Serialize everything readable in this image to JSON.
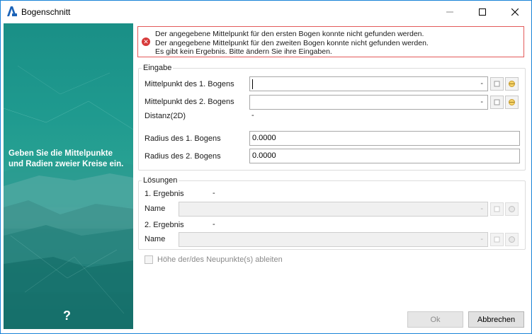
{
  "window": {
    "title": "Bogenschnitt",
    "accent_color": "#1883d7"
  },
  "side_panel": {
    "hint": "Geben Sie die Mittelpunkte und Radien zweier Kreise ein.",
    "help_glyph": "?"
  },
  "errors": {
    "icon": "error-icon",
    "lines": [
      "Der angegebene Mittelpunkt für den ersten Bogen konnte nicht gefunden werden.",
      "Der angegebene Mittelpunkt für den zweiten Bogen konnte nicht gefunden werden.",
      "Es gibt kein Ergebnis. Bitte ändern Sie ihre Eingaben."
    ],
    "color": "#d73a3a"
  },
  "input_group": {
    "title": "Eingabe",
    "center1_label": "Mittelpunkt des 1. Bogens",
    "center1_value": "-",
    "center2_label": "Mittelpunkt des 2. Bogens",
    "center2_value": "-",
    "distance_label": "Distanz(2D)",
    "distance_value": "-",
    "radius1_label": "Radius des 1. Bogens",
    "radius1_value": "0.0000",
    "radius2_label": "Radius des 2. Bogens",
    "radius2_value": "0.0000"
  },
  "solutions_group": {
    "title": "Lösungen",
    "result1_label": "1. Ergebnis",
    "result1_value": "-",
    "name1_label": "Name",
    "name1_value": "-",
    "result2_label": "2. Ergebnis",
    "result2_value": "-",
    "name2_label": "Name",
    "name2_value": "-"
  },
  "options": {
    "derive_height_label": "Höhe der/des Neupunkte(s) ableiten",
    "derive_height_checked": false
  },
  "buttons": {
    "ok": "Ok",
    "cancel": "Abbrechen"
  }
}
